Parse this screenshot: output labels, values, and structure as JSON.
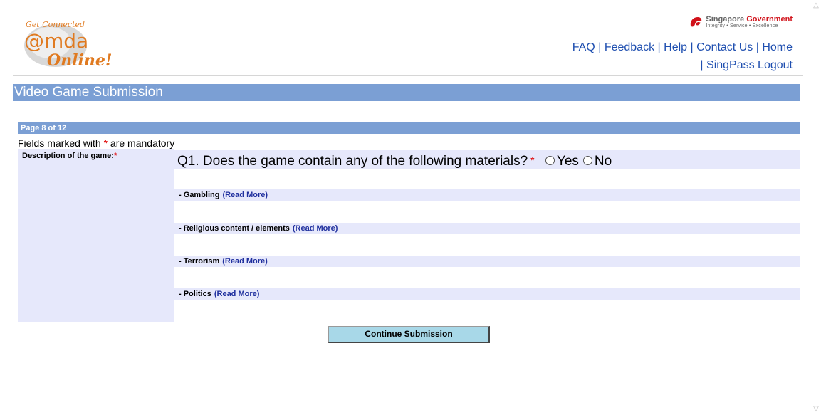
{
  "header": {
    "logo_text": [
      "Get Connected",
      "@mda",
      "Online!"
    ],
    "gov_name_1": "Singapore ",
    "gov_name_2": "Government",
    "gov_tagline": "Integrity • Service • Excellence",
    "links": [
      "FAQ",
      "Feedback",
      "Help",
      "Contact Us",
      "Home",
      "SingPass Logout"
    ]
  },
  "title": "Video Game Submission",
  "page_indicator": "Page 8 of 12",
  "mandatory_note_before": "Fields marked with ",
  "mandatory_star": "*",
  "mandatory_note_after": " are mandatory",
  "form": {
    "field_label": "Description of the game:",
    "question": "Q1. Does the game contain any of the following materials?",
    "options": [
      "Yes",
      "No"
    ],
    "items": [
      {
        "label": "- Gambling",
        "link": "(Read More)"
      },
      {
        "label": "- Religious content / elements",
        "link": "(Read More)"
      },
      {
        "label": "- Terrorism",
        "link": "(Read More)"
      },
      {
        "label": "- Politics",
        "link": "(Read More)"
      }
    ]
  },
  "continue_button": "Continue Submission",
  "colors": {
    "bar": "#7b9fd4",
    "panel": "#e6e8fb",
    "link": "#1f4fb0",
    "button": "#a8d8e8"
  }
}
